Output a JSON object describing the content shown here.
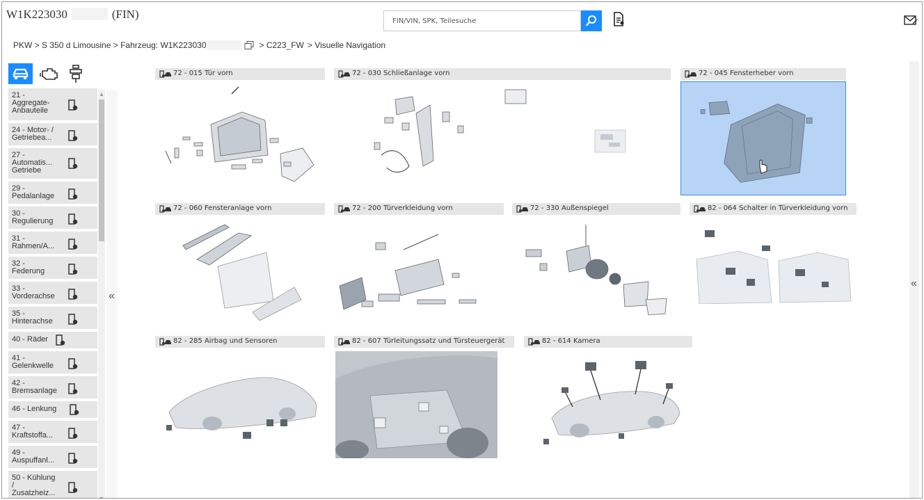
{
  "header": {
    "title_prefix": "W1K223030",
    "title_suffix": "(FIN)",
    "search_placeholder": "FIN/VIN, SPK, Teilesuche",
    "icons": [
      "search-icon",
      "document-icon",
      "mail-icon"
    ]
  },
  "breadcrumb": {
    "part1": "PKW > S 350 d Limousine > Fahrzeug: W1K223030",
    "part2": "> C223_FW",
    "part3": "> Visuelle Navigation"
  },
  "tabs": [
    "car-icon",
    "engine-icon",
    "seat-icon"
  ],
  "sidebar": {
    "items": [
      {
        "label": "21 -\nAggregate-\nAnbauteile"
      },
      {
        "label": "24 - Motor- /\nGetriebea..."
      },
      {
        "label": "27 -\nAutomatis...\nGetriebe"
      },
      {
        "label": "29 -\nPedalanlage"
      },
      {
        "label": "30 -\nRegulierung"
      },
      {
        "label": "31 -\nRahmen/A..."
      },
      {
        "label": "32 -\nFederung"
      },
      {
        "label": "33 -\nVorderachse"
      },
      {
        "label": "35 -\nHinterachse"
      },
      {
        "label": "40 - Räder"
      },
      {
        "label": "41 -\nGelenkwelle"
      },
      {
        "label": "42 -\nBremsanlage"
      },
      {
        "label": "46 - Lenkung"
      },
      {
        "label": "47 -\nKraftstoffa..."
      },
      {
        "label": "49 -\nAuspuffanl..."
      },
      {
        "label": "50 - Kühlung\n/\nZusatzheiz..."
      }
    ]
  },
  "collapse": {
    "left": "«",
    "right": "«"
  },
  "tiles": [
    {
      "label": "72 - 015 Tür vorn"
    },
    {
      "label": "72 - 030 Schließanlage vorn"
    },
    {
      "label": "72 - 045 Fensterheber vorn",
      "selected": true
    },
    {
      "label": "72 - 060 Fensteranlage vorn"
    },
    {
      "label": "72 - 200 Türverkleidung vorn"
    },
    {
      "label": "72 - 330 Außenspiegel"
    },
    {
      "label": "82 - 064 Schalter in Türverkleidung vorn"
    },
    {
      "label": "82 - 285 Airbag und Sensoren"
    },
    {
      "label": "82 - 607 Türleitungssatz und Türsteuergerät"
    },
    {
      "label": "82 - 614 Kamera"
    }
  ],
  "colors": {
    "accent": "#1a8cff",
    "selection": "#b7d4f6",
    "item_bg": "#e6e6e6"
  }
}
